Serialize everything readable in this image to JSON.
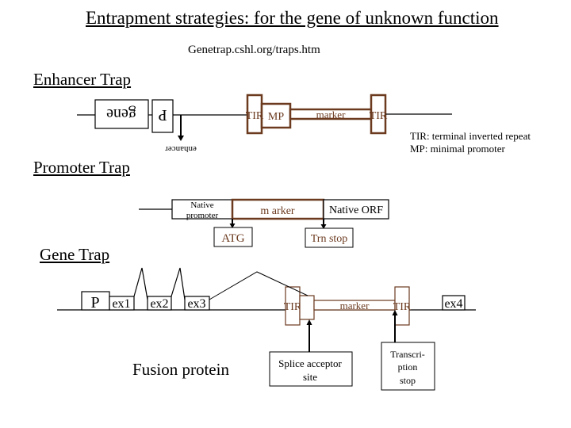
{
  "title": "Entrapment strategies: for the gene of unknown function",
  "subtitle": "Genetrap.cshl.org/traps.htm",
  "colors": {
    "vector": "#6b3a1f",
    "line": "#000000"
  },
  "enhancer_trap": {
    "heading": "Enhancer Trap",
    "gene_label": "gene",
    "promoter_label": "P",
    "enhancer_label": "enhancer",
    "tir_left": "TIR",
    "mp_label": "MP",
    "marker_label": "marker",
    "tir_right": "TIR"
  },
  "legend": {
    "line1": "TIR: terminal inverted repeat",
    "line2": "MP: minimal promoter"
  },
  "promoter_trap": {
    "heading": "Promoter Trap",
    "native_promoter_line1": "Native",
    "native_promoter_line2": "promoter",
    "marker_label": "m arker",
    "native_orf": "Native ORF",
    "atg": "ATG",
    "trn_stop": "Trn stop"
  },
  "gene_trap": {
    "heading": "Gene Trap",
    "promoter_label": "P",
    "exons": [
      "ex1",
      "ex2",
      "ex3",
      "ex4"
    ],
    "tir_left": "TIR",
    "marker_label": "marker",
    "tir_right": "TIR",
    "splice_line1": "Splice acceptor",
    "splice_line2": "site",
    "stop_line1": "Transcri-",
    "stop_line2": "ption",
    "stop_line3": "stop",
    "fusion_label": "Fusion protein"
  }
}
